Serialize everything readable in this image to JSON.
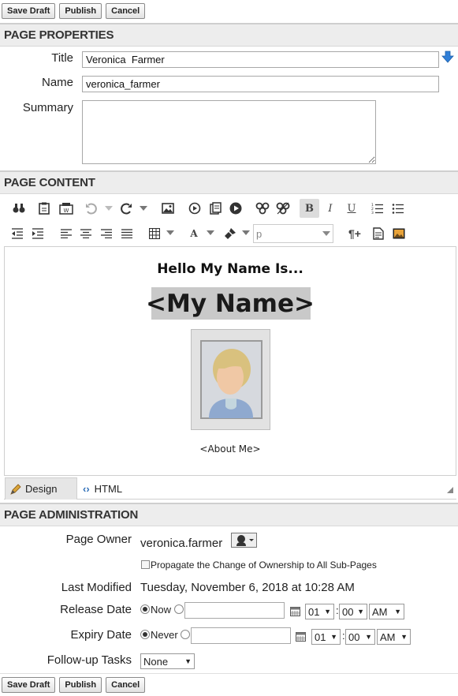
{
  "toolbar": {
    "save_draft": "Save Draft",
    "publish": "Publish",
    "cancel": "Cancel"
  },
  "sections": {
    "properties": "PAGE PROPERTIES",
    "content": "PAGE CONTENT",
    "administration": "PAGE ADMINISTRATION"
  },
  "properties": {
    "title_label": "Title",
    "title_value": "Veronica  Farmer",
    "name_label": "Name",
    "name_value": "veronica_farmer",
    "summary_label": "Summary",
    "summary_value": ""
  },
  "editor": {
    "format_select": "p",
    "heading": "Hello My Name Is...",
    "name_banner": "<My Name>",
    "about_link": "<About Me>",
    "tabs": {
      "design": "Design",
      "html": "HTML"
    }
  },
  "admin": {
    "owner_label": "Page Owner",
    "owner_value": "veronica.farmer",
    "propagate_label": "Propagate the Change of Ownership to All Sub-Pages",
    "last_modified_label": "Last Modified",
    "last_modified_value": "Tuesday, November 6, 2018 at 10:28 AM",
    "release_label": "Release Date",
    "release_now": "Now",
    "release_hour": "01",
    "release_minute": "00",
    "release_ampm": "AM",
    "expiry_label": "Expiry Date",
    "expiry_never": "Never",
    "expiry_hour": "01",
    "expiry_minute": "00",
    "expiry_ampm": "AM",
    "followup_label": "Follow-up Tasks",
    "followup_value": "None"
  },
  "colors": {
    "section_bg": "#ededed",
    "name_highlight": "#c9c9c9",
    "download_arrow": "#2f7fd8"
  }
}
